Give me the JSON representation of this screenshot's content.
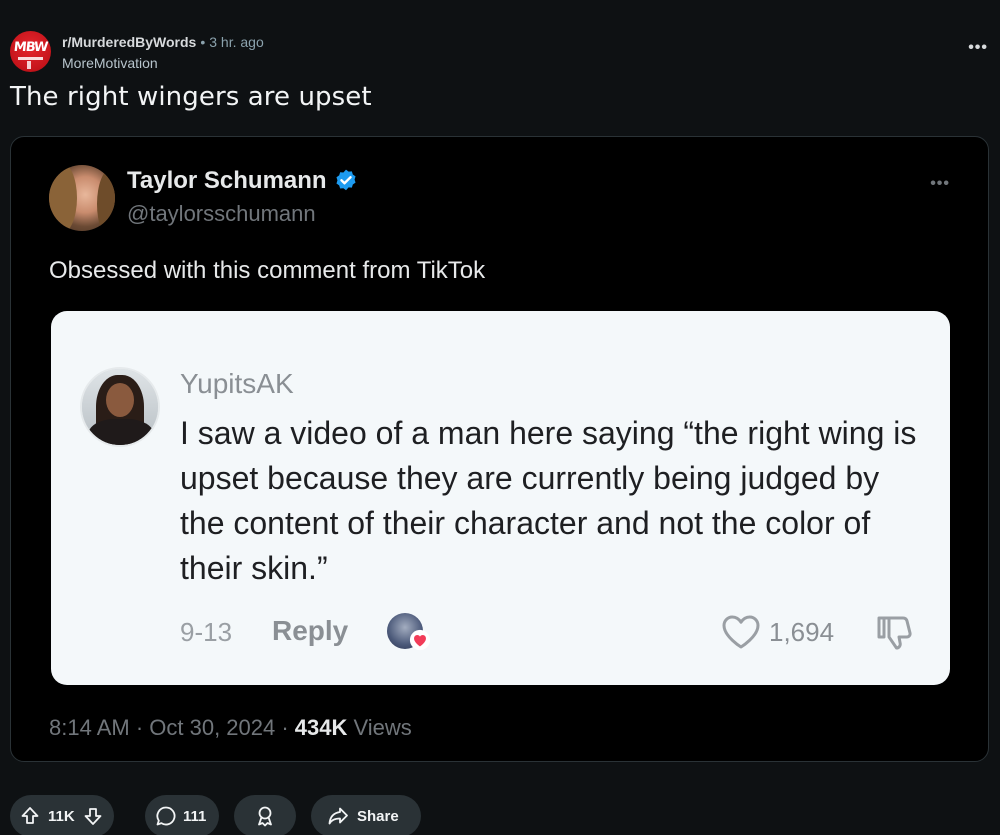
{
  "post": {
    "subreddit": "r/MurderedByWords",
    "separator": "•",
    "time": "3 hr. ago",
    "author": "MoreMotivation",
    "title": "The right wingers are upset",
    "overflow": "•••"
  },
  "tweet": {
    "name": "Taylor Schumann",
    "handle": "@taylorsschumann",
    "more": "•••",
    "text": "Obsessed with this comment from TikTok",
    "meta_prefix": "8:14 AM · Oct 30, 2024 · ",
    "views_count": "434K",
    "views_label": " Views"
  },
  "tiktok_comment": {
    "username": "YupitsAK",
    "comment": "I saw a video of a man here saying “the right wing is upset because they are currently being judged by the content of their character and not the color of their skin.”",
    "date": "9-13",
    "reply_label": "Reply",
    "likes": "1,694"
  },
  "actions": {
    "votes": "11K",
    "comments": "111",
    "share_label": "Share"
  },
  "icons": {
    "subreddit_avatar": "murderedbywords-logo",
    "verified": "verified-badge-icon",
    "like": "heart-outline-icon",
    "dislike": "thumbs-down-icon",
    "upvote": "upvote-arrow-icon",
    "downvote": "downvote-arrow-icon",
    "comment": "comment-bubble-icon",
    "award": "award-icon",
    "share": "share-arrow-icon"
  },
  "colors": {
    "background": "#0e1113",
    "pill": "#2a3236",
    "verified_blue": "#1d9bf0",
    "heart_red": "#f23c58"
  }
}
